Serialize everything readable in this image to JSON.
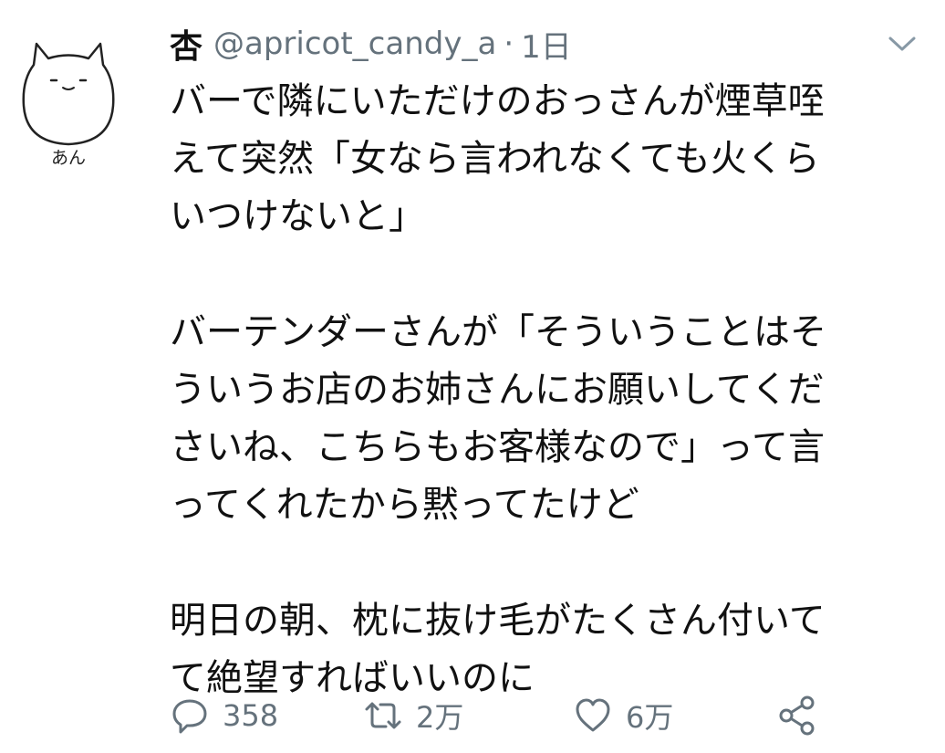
{
  "avatar": {
    "caption": "あん"
  },
  "tweet": {
    "display_name": "杏",
    "handle": "@apricot_candy_a",
    "separator": "·",
    "time": "1日",
    "paragraphs": [
      [
        "バーで隣にいただけのおっさんが煙草咥",
        "えて突然「女なら言われなくても火くら",
        "いつけないと」"
      ],
      [
        "バーテンダーさんが「そういうことはそ",
        "ういうお店のお姉さんにお願いしてくだ",
        "さいね、こちらもお客様なので」って言",
        "ってくれたから黙ってたけど"
      ],
      [
        "明日の朝、枕に抜け毛がたくさん付いて",
        "て絶望すればいいのに"
      ]
    ]
  },
  "actions": {
    "reply_count": "358",
    "retweet_count": "2万",
    "like_count": "6万"
  },
  "icons": {
    "reply": "speech-bubble-icon",
    "retweet": "retweet-arrows-icon",
    "like": "heart-icon",
    "share": "share-icon",
    "menu": "chevron-down-icon"
  },
  "colors": {
    "text": "#111111",
    "muted": "#65727c",
    "background": "#ffffff"
  }
}
